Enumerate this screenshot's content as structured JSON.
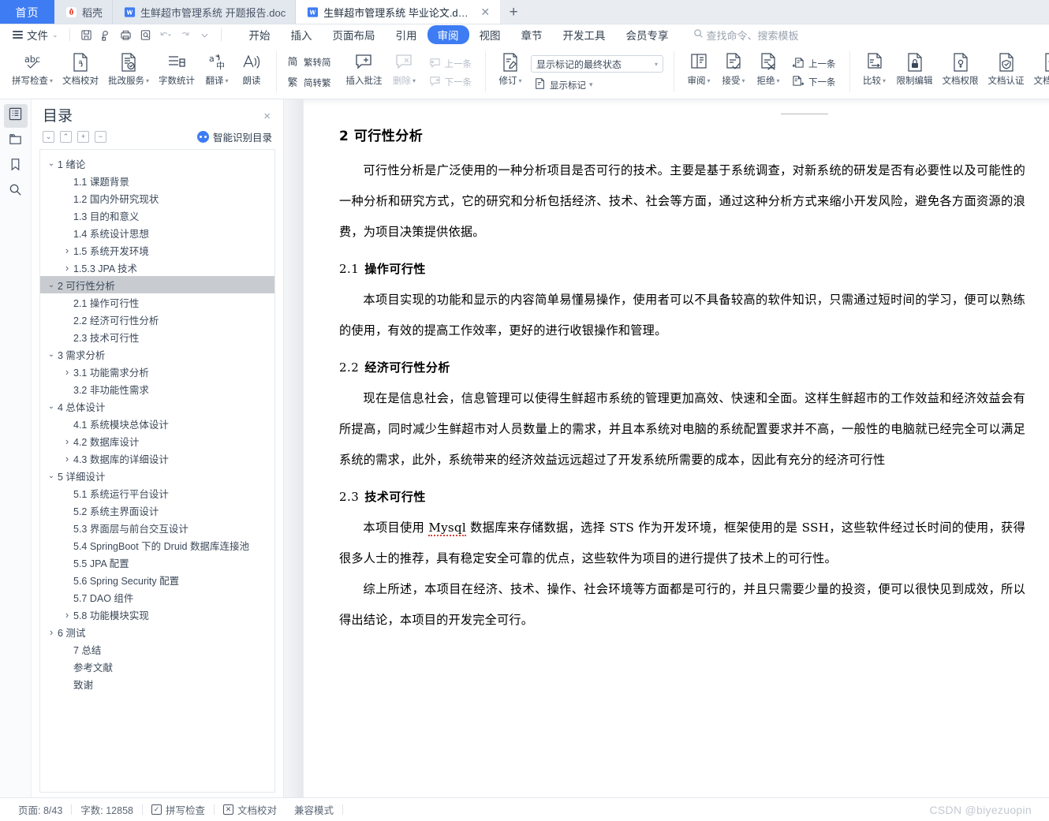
{
  "tabbar": {
    "home_label": "首页",
    "tabs": [
      {
        "label": "稻壳",
        "icon": "daoke-icon",
        "active": false,
        "closable": false
      },
      {
        "label": "生鲜超市管理系统 开题报告.doc",
        "icon": "wps-word-icon",
        "active": false,
        "closable": false
      },
      {
        "label": "生鲜超市管理系统 毕业论文.docx",
        "icon": "wps-word-icon",
        "active": true,
        "closable": true
      }
    ],
    "new_tab_label": "+"
  },
  "menu": {
    "file_label": "文件",
    "quick_access": [
      "save-icon",
      "print-preview-icon",
      "print-icon",
      "find-icon",
      "undo-icon",
      "redo-icon",
      "customize-icon"
    ],
    "ribbon_tabs": [
      {
        "label": "开始",
        "active": false
      },
      {
        "label": "插入",
        "active": false
      },
      {
        "label": "页面布局",
        "active": false
      },
      {
        "label": "引用",
        "active": false
      },
      {
        "label": "审阅",
        "active": true
      },
      {
        "label": "视图",
        "active": false
      },
      {
        "label": "章节",
        "active": false
      },
      {
        "label": "开发工具",
        "active": false
      },
      {
        "label": "会员专享",
        "active": false
      }
    ],
    "search_placeholder": "查找命令、搜索模板"
  },
  "ribbon": {
    "group1": [
      {
        "label": "拼写检查",
        "icon": "spellcheck-abc-icon",
        "dropdown": true,
        "dim": false
      },
      {
        "label": "文档校对",
        "icon": "document-proofread-icon",
        "dropdown": false,
        "dim": false
      },
      {
        "label": "批改服务",
        "icon": "correction-service-icon",
        "dropdown": true,
        "dim": false
      },
      {
        "label": "字数统计",
        "icon": "word-count-icon",
        "dropdown": false,
        "dim": false
      },
      {
        "label": "翻译",
        "icon": "translate-icon",
        "dropdown": true,
        "dim": false
      },
      {
        "label": "朗读",
        "icon": "read-aloud-icon",
        "dropdown": false,
        "dim": false
      }
    ],
    "group2": [
      {
        "label": "繁转简",
        "icon": "trad-to-simp-icon",
        "dim": false
      },
      {
        "label": "简转繁",
        "icon": "simp-to-trad-icon",
        "dim": false
      }
    ],
    "group3": [
      {
        "label": "插入批注",
        "icon": "insert-comment-icon",
        "dropdown": false,
        "dim": false
      },
      {
        "label": "删除",
        "icon": "delete-comment-icon",
        "dropdown": true,
        "dim": true
      }
    ],
    "group3b": [
      {
        "label": "上一条",
        "icon": "prev-comment-icon",
        "dim": true
      },
      {
        "label": "下一条",
        "icon": "next-comment-icon",
        "dim": true
      }
    ],
    "group4": [
      {
        "label": "修订",
        "icon": "track-changes-icon",
        "dropdown": true,
        "dim": false
      }
    ],
    "markup_select_value": "显示标记的最终状态",
    "show_markup_label": "显示标记",
    "group5": [
      {
        "label": "审阅",
        "icon": "reviewing-pane-icon",
        "dropdown": true,
        "dim": false
      },
      {
        "label": "接受",
        "icon": "accept-change-icon",
        "dropdown": true,
        "dim": false
      },
      {
        "label": "拒绝",
        "icon": "reject-change-icon",
        "dropdown": true,
        "dim": false
      }
    ],
    "group5b": [
      {
        "label": "上一条",
        "icon": "prev-change-icon",
        "dim": false
      },
      {
        "label": "下一条",
        "icon": "next-change-icon",
        "dim": false
      }
    ],
    "group6": [
      {
        "label": "比较",
        "icon": "compare-icon",
        "dropdown": true,
        "dim": false
      },
      {
        "label": "限制编辑",
        "icon": "restrict-edit-lock-icon",
        "dropdown": false,
        "dim": false
      },
      {
        "label": "文档权限",
        "icon": "document-permission-icon",
        "dropdown": false,
        "dim": false
      },
      {
        "label": "文档认证",
        "icon": "document-certify-icon",
        "dropdown": false,
        "dim": false
      },
      {
        "label": "文档定稿",
        "icon": "document-finalize-icon",
        "dropdown": false,
        "dim": false
      }
    ]
  },
  "leftrail": {
    "items": [
      {
        "icon": "outline-pane-icon",
        "active": true
      },
      {
        "icon": "thumbnail-pane-icon",
        "active": false
      },
      {
        "icon": "bookmark-pane-icon",
        "active": false
      },
      {
        "icon": "search-pane-icon",
        "active": false
      }
    ]
  },
  "navpane": {
    "title": "目录",
    "close_label": "×",
    "tools": [
      {
        "icon": "collapse-down-icon",
        "glyph": "⌄"
      },
      {
        "icon": "collapse-up-icon",
        "glyph": "⌃"
      },
      {
        "icon": "expand-all-icon",
        "glyph": "+"
      },
      {
        "icon": "collapse-all-icon",
        "glyph": "−"
      }
    ],
    "smart_toc_label": "智能识别目录",
    "toc": [
      {
        "label": "1 绪论",
        "indent": 0,
        "arrow": "down",
        "selected": false
      },
      {
        "label": "1.1 课题背景",
        "indent": 1,
        "arrow": "none",
        "selected": false
      },
      {
        "label": "1.2 国内外研究现状",
        "indent": 1,
        "arrow": "none",
        "selected": false
      },
      {
        "label": "1.3 目的和意义",
        "indent": 1,
        "arrow": "none",
        "selected": false
      },
      {
        "label": "1.4 系统设计思想",
        "indent": 1,
        "arrow": "none",
        "selected": false
      },
      {
        "label": "1.5 系统开发环境",
        "indent": 1,
        "arrow": "right",
        "selected": false
      },
      {
        "label": "1.5.3   JPA 技术",
        "indent": 1,
        "arrow": "right",
        "selected": false
      },
      {
        "label": "2 可行性分析",
        "indent": 0,
        "arrow": "down",
        "selected": true
      },
      {
        "label": "2.1 操作可行性",
        "indent": 1,
        "arrow": "none",
        "selected": false
      },
      {
        "label": "2.2 经济可行性分析",
        "indent": 1,
        "arrow": "none",
        "selected": false
      },
      {
        "label": "2.3 技术可行性",
        "indent": 1,
        "arrow": "none",
        "selected": false
      },
      {
        "label": "3 需求分析",
        "indent": 0,
        "arrow": "down",
        "selected": false
      },
      {
        "label": "3.1 功能需求分析",
        "indent": 1,
        "arrow": "right",
        "selected": false
      },
      {
        "label": "3.2 非功能性需求",
        "indent": 1,
        "arrow": "none",
        "selected": false
      },
      {
        "label": "4 总体设计",
        "indent": 0,
        "arrow": "down",
        "selected": false
      },
      {
        "label": "4.1 系统模块总体设计",
        "indent": 1,
        "arrow": "none",
        "selected": false
      },
      {
        "label": "4.2 数据库设计",
        "indent": 1,
        "arrow": "right",
        "selected": false
      },
      {
        "label": "4.3 数据库的详细设计",
        "indent": 1,
        "arrow": "right",
        "selected": false
      },
      {
        "label": "5 详细设计",
        "indent": 0,
        "arrow": "down",
        "selected": false
      },
      {
        "label": "5.1 系统运行平台设计",
        "indent": 1,
        "arrow": "none",
        "selected": false
      },
      {
        "label": "5.2 系统主界面设计",
        "indent": 1,
        "arrow": "none",
        "selected": false
      },
      {
        "label": "5.3 界面层与前台交互设计",
        "indent": 1,
        "arrow": "none",
        "selected": false
      },
      {
        "label": "5.4 SpringBoot 下的 Druid 数据库连接池",
        "indent": 1,
        "arrow": "none",
        "selected": false
      },
      {
        "label": "5.5 JPA 配置",
        "indent": 1,
        "arrow": "none",
        "selected": false
      },
      {
        "label": "5.6 Spring Security 配置",
        "indent": 1,
        "arrow": "none",
        "selected": false
      },
      {
        "label": "5.7 DAO 组件",
        "indent": 1,
        "arrow": "none",
        "selected": false
      },
      {
        "label": "5.8 功能模块实现",
        "indent": 1,
        "arrow": "right",
        "selected": false
      },
      {
        "label": "6 测试",
        "indent": 0,
        "arrow": "right",
        "selected": false
      },
      {
        "label": "7 总结",
        "indent": 1,
        "arrow": "none",
        "selected": false
      },
      {
        "label": "参考文献",
        "indent": 1,
        "arrow": "none",
        "selected": false
      },
      {
        "label": "致谢",
        "indent": 1,
        "arrow": "none",
        "selected": false
      }
    ]
  },
  "document": {
    "heading": "2 可行性分析",
    "para1": "可行性分析是广泛使用的一种分析项目是否可行的技术。主要是基于系统调查，对新系统的研发是否有必要性以及可能性的一种分析和研究方式，它的研究和分析包括经济、技术、社会等方面，通过这种分析方式来缩小开发风险，避免各方面资源的浪费，为项目决策提供依据。",
    "h21_num": "2.1",
    "h21_text": "操作可行性",
    "para2": "本项目实现的功能和显示的内容简单易懂易操作，使用者可以不具备较高的软件知识，只需通过短时间的学习，便可以熟练的使用，有效的提高工作效率，更好的进行收银操作和管理。",
    "h22_num": "2.2",
    "h22_text": "经济可行性分析",
    "para3": "现在是信息社会，信息管理可以使得生鲜超市系统的管理更加高效、快速和全面。这样生鲜超市的工作效益和经济效益会有所提高，同时减少生鲜超市对人员数量上的需求，并且本系统对电脑的系统配置要求并不高，一般性的电脑就已经完全可以满足系统的需求，此外，系统带来的经济效益远远超过了开发系统所需要的成本，因此有充分的经济可行性",
    "h23_num": "2.3",
    "h23_text": "技术可行性",
    "para4_a": "本项目使用 ",
    "para4_mysql": "Mysql",
    "para4_b": " 数据库来存储数据，选择 ",
    "para4_sts": "STS",
    "para4_c": " 作为开发环境，框架使用的是 ",
    "para4_ssh": "SSH",
    "para4_d": "，这些软件经过长时间的使用，获得很多人士的推荐，具有稳定安全可靠的优点，这些软件为项目的进行提供了技术上的可行性。",
    "para5": "综上所述，本项目在经济、技术、操作、社会环境等方面都是可行的，并且只需要少量的投资，便可以很快见到成效，所以得出结论，本项目的开发完全可行。"
  },
  "statusbar": {
    "page_label": "页面: 8/43",
    "words_label": "字数: 12858",
    "spellcheck_label": "拼写检查",
    "proofread_label": "文档校对",
    "compat_label": "兼容模式",
    "watermark": "CSDN @biyezuopin"
  },
  "colors": {
    "accent": "#3e7cf3",
    "tab_active_bg": "#ffffff",
    "toc_selected_bg": "#c8ccd1",
    "text": "#3b4859"
  }
}
